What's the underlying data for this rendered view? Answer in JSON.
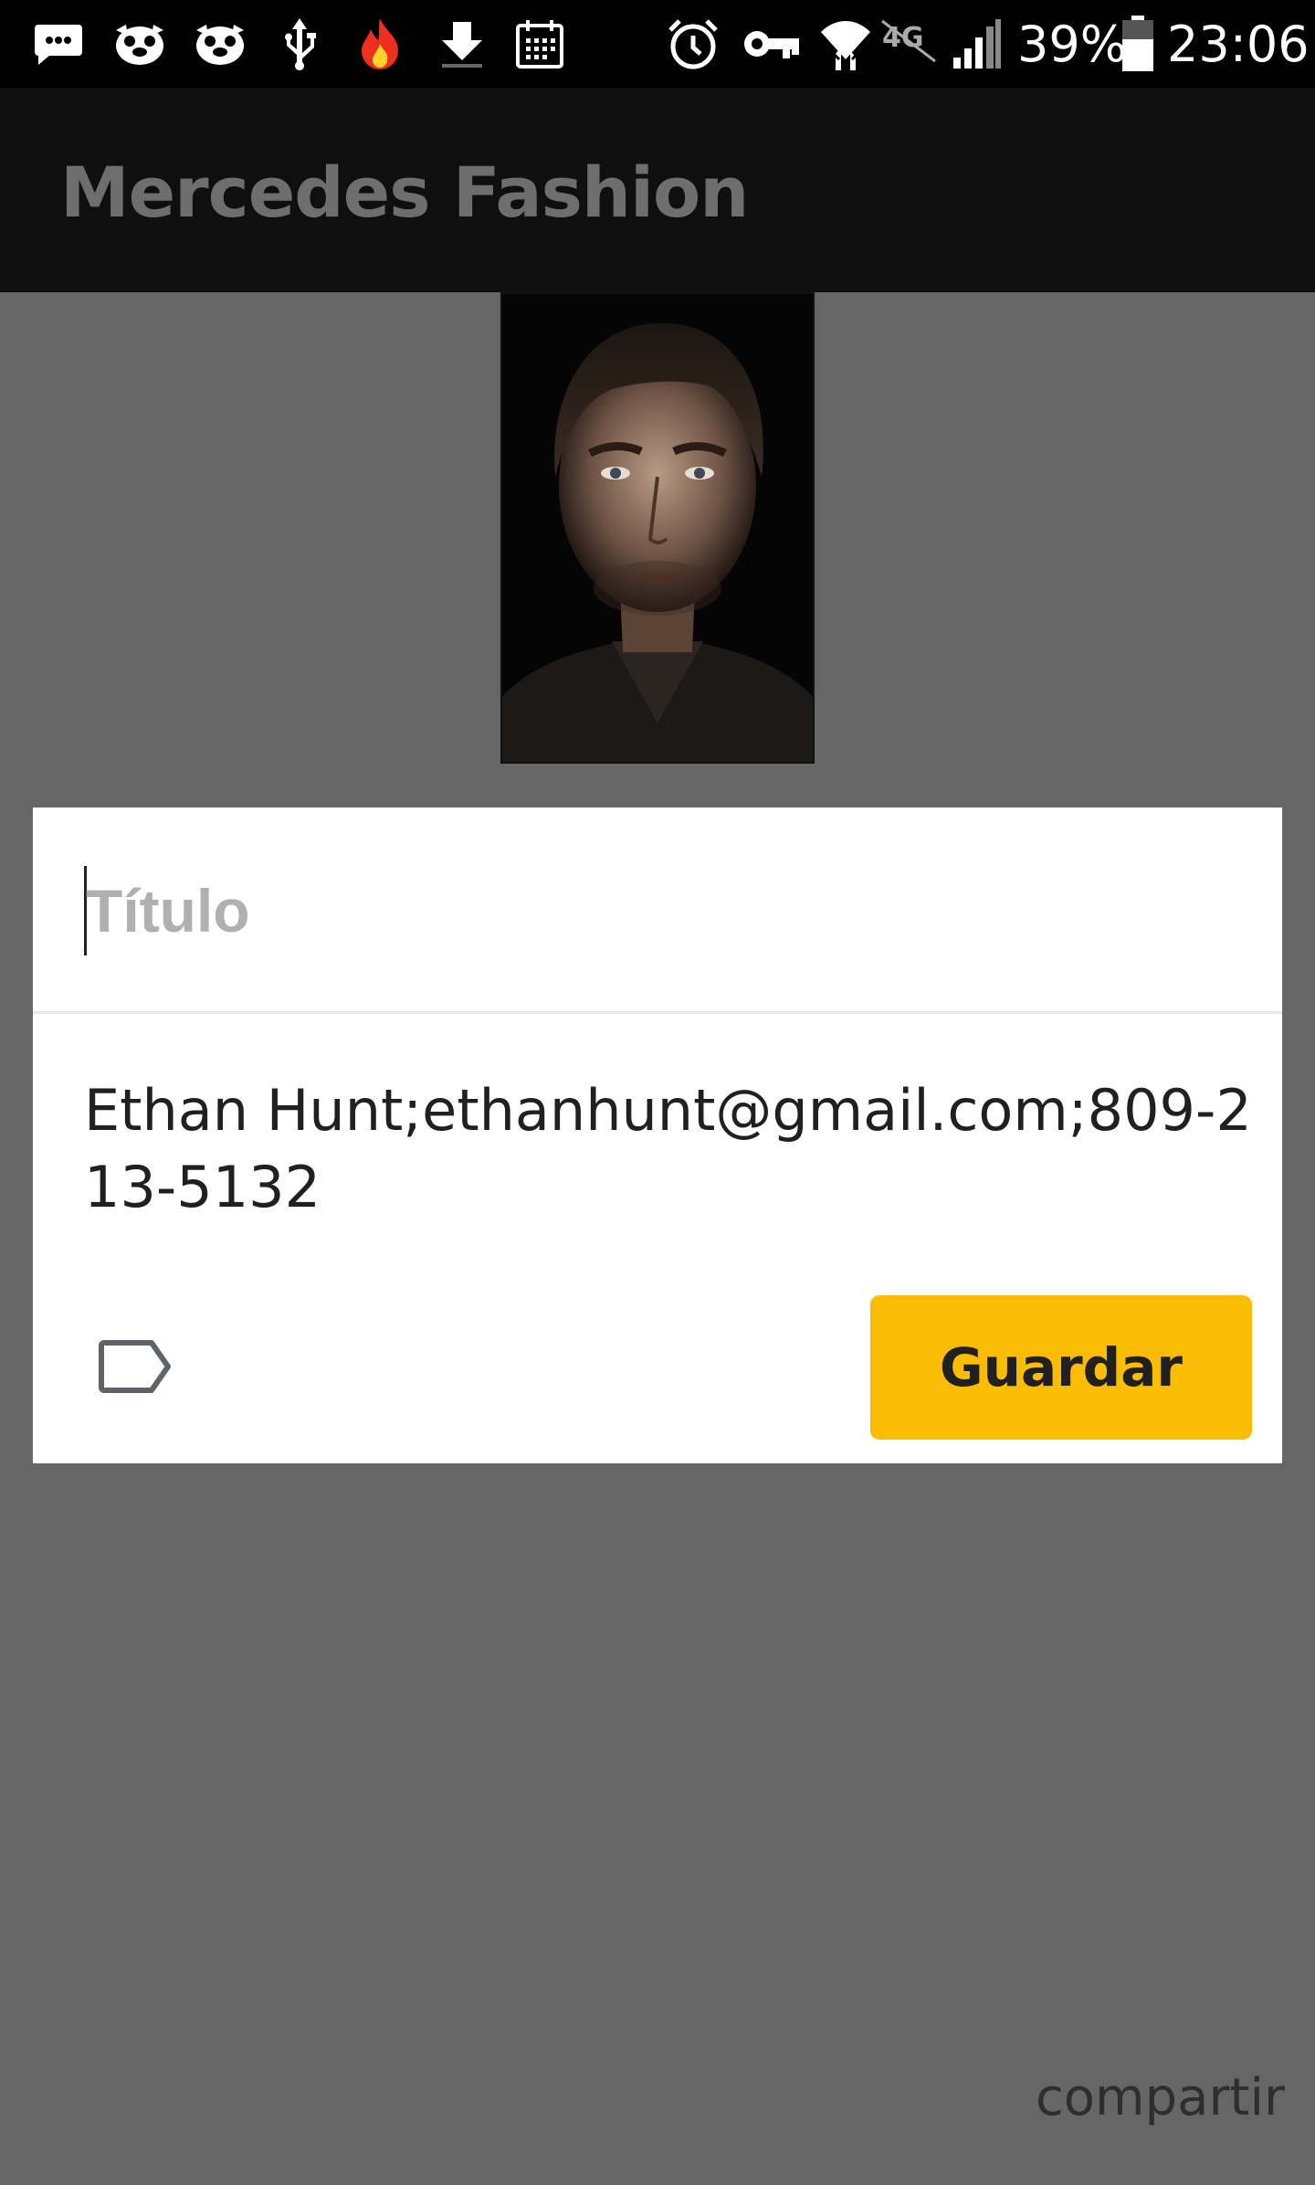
{
  "status_bar": {
    "battery_percent": "39%",
    "time": "23:06",
    "network_label": "4G",
    "icons": [
      "chat-bubble-icon",
      "pug-icon",
      "pug-icon",
      "usb-icon",
      "flame-icon",
      "download-icon",
      "calendar-icon",
      "alarm-icon",
      "key-icon",
      "wifi-icon",
      "network-type-icon",
      "signal-icon",
      "battery-icon"
    ]
  },
  "app_bar": {
    "title": "Mercedes Fashion"
  },
  "note_card": {
    "title_placeholder": "Título",
    "title_value": "",
    "body_text": "Ethan Hunt;ethanhunt@gmail.com;809-213-5132",
    "save_label": "Guardar",
    "save_color": "#fbbc04",
    "label_icon": "label-outline-icon"
  },
  "footer": {
    "share_label": "compartir"
  },
  "colors": {
    "scrim": "#666666",
    "app_bar": "#0f0f0f",
    "status_bar": "#000000"
  }
}
